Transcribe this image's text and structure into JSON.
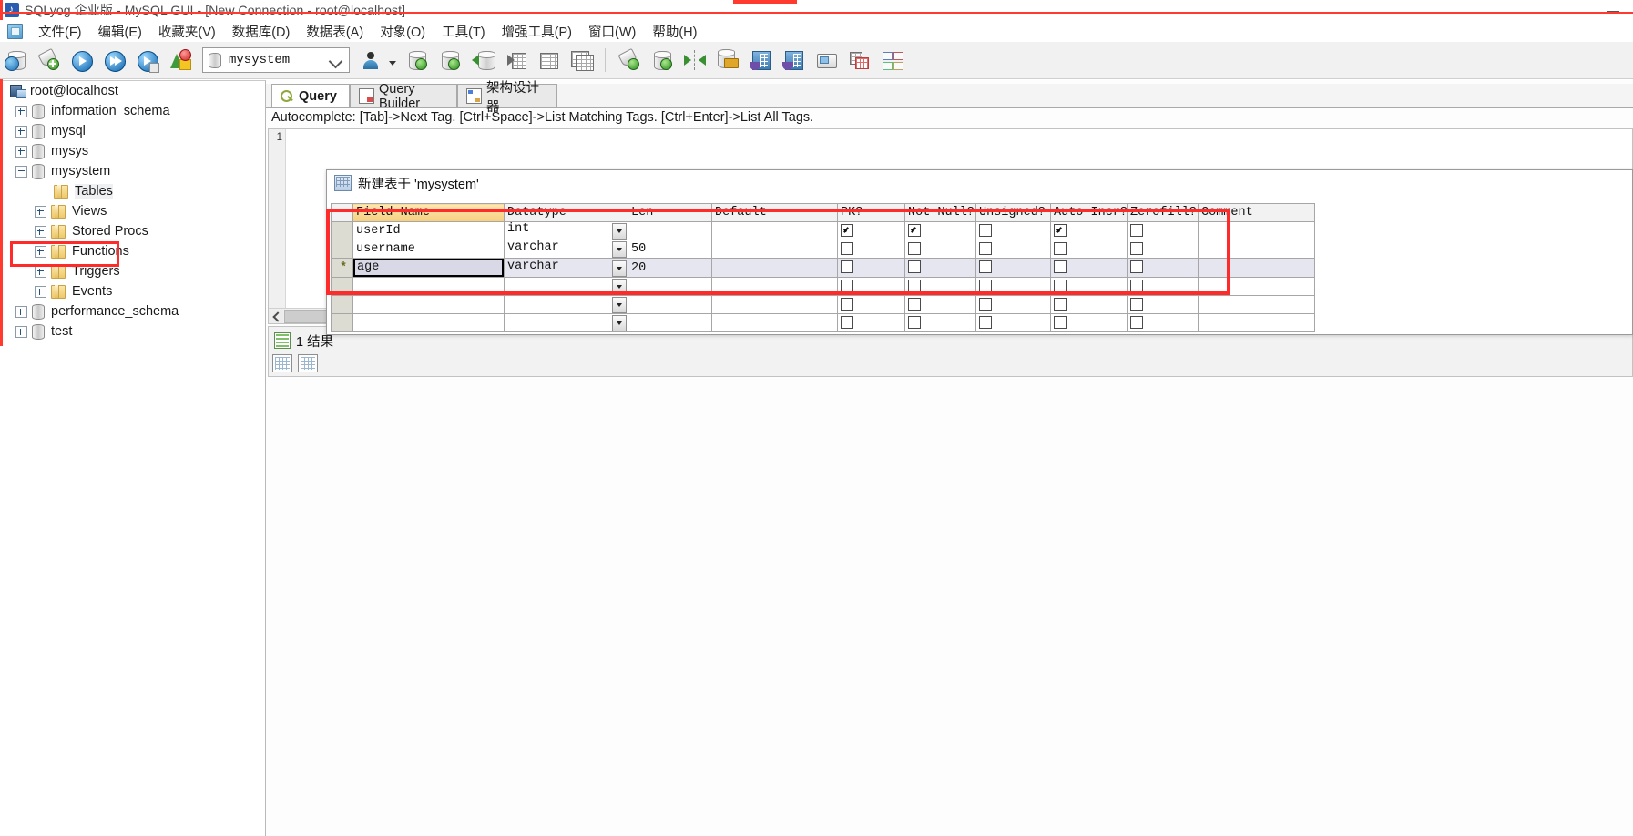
{
  "window": {
    "title": "SQLyog 企业版 - MySQL GUI - [New Connection - root@localhost]",
    "minimize_label": "—"
  },
  "menu": {
    "items": [
      {
        "label": "文件(F)",
        "name": "menu-file"
      },
      {
        "label": "编辑(E)",
        "name": "menu-edit"
      },
      {
        "label": "收藏夹(V)",
        "name": "menu-favorites"
      },
      {
        "label": "数据库(D)",
        "name": "menu-database"
      },
      {
        "label": "数据表(A)",
        "name": "menu-table"
      },
      {
        "label": "对象(O)",
        "name": "menu-object"
      },
      {
        "label": "工具(T)",
        "name": "menu-tools"
      },
      {
        "label": "增强工具(P)",
        "name": "menu-powertools"
      },
      {
        "label": "窗口(W)",
        "name": "menu-window"
      },
      {
        "label": "帮助(H)",
        "name": "menu-help"
      }
    ]
  },
  "toolbar": {
    "database_selector": {
      "value": "mysystem",
      "icon": "database-icon",
      "chevron": "chevron-down-icon"
    },
    "icons": [
      "new-connection-icon",
      "new-query-icon",
      "execute-query-icon",
      "execute-all-queries-icon",
      "execute-query-stop-icon",
      "refresh-objects-icon",
      "user-manager-icon",
      "import-database-icon",
      "export-database-icon",
      "restore-backup-icon",
      "table-data-icon",
      "table-info-icon",
      "copy-table-icon",
      "format-query-icon",
      "refresh-database-icon",
      "sync-data-icon",
      "backup-database-icon",
      "schema-sync-icon",
      "migration-icon",
      "scheduled-backup-icon",
      "notification-icon"
    ]
  },
  "sidebar": {
    "root": {
      "label": "root@localhost",
      "icon": "server-icon"
    },
    "items": [
      {
        "label": "information_schema",
        "icon": "database-icon",
        "expander": "plus",
        "indent": 1
      },
      {
        "label": "mysql",
        "icon": "database-icon",
        "expander": "plus",
        "indent": 1
      },
      {
        "label": "mysys",
        "icon": "database-icon",
        "expander": "plus",
        "indent": 1
      },
      {
        "label": "mysystem",
        "icon": "database-icon",
        "expander": "minus",
        "indent": 1,
        "highlighted": true
      },
      {
        "label": "Tables",
        "icon": "folder-icon",
        "expander": "none",
        "indent": 2,
        "selected": true
      },
      {
        "label": "Views",
        "icon": "folder-icon",
        "expander": "plus",
        "indent": 2
      },
      {
        "label": "Stored Procs",
        "icon": "folder-icon",
        "expander": "plus",
        "indent": 2
      },
      {
        "label": "Functions",
        "icon": "folder-icon",
        "expander": "plus",
        "indent": 2
      },
      {
        "label": "Triggers",
        "icon": "folder-icon",
        "expander": "plus",
        "indent": 2
      },
      {
        "label": "Events",
        "icon": "folder-icon",
        "expander": "plus",
        "indent": 2
      },
      {
        "label": "performance_schema",
        "icon": "database-icon",
        "expander": "plus",
        "indent": 1
      },
      {
        "label": "test",
        "icon": "database-icon",
        "expander": "plus",
        "indent": 1
      }
    ]
  },
  "editor_area": {
    "tabs": [
      {
        "label": "Query",
        "icon": "query-icon",
        "active": true
      },
      {
        "label": "Query Builder",
        "icon": "query-builder-icon",
        "active": false
      },
      {
        "label": "架构设计器",
        "icon": "schema-designer-icon",
        "active": false
      }
    ],
    "autocomplete_hint": "Autocomplete: [Tab]->Next Tag. [Ctrl+Space]->List Matching Tags. [Ctrl+Enter]->List All Tags.",
    "line_numbers": [
      "1"
    ],
    "content": ""
  },
  "results": {
    "tab_label": "1 结果",
    "icon": "result-grid-icon"
  },
  "dialog": {
    "title": "新建表于 'mysystem'",
    "icon": "new-table-icon",
    "columns": [
      "Field Name",
      "Datatype",
      "Len",
      "Default",
      "PK?",
      "Not Null?",
      "Unsigned?",
      "Auto Incr?",
      "Zerofill?",
      "Comment"
    ],
    "rows": [
      {
        "marker": "",
        "field_name": "userId",
        "datatype": "int",
        "len": "",
        "default": "",
        "pk": true,
        "not_null": true,
        "unsigned": false,
        "auto_incr": true,
        "zerofill": false,
        "comment": "",
        "selected": false,
        "editing": false
      },
      {
        "marker": "",
        "field_name": "username",
        "datatype": "varchar",
        "len": "50",
        "default": "",
        "pk": false,
        "not_null": false,
        "unsigned": false,
        "auto_incr": false,
        "zerofill": false,
        "comment": "",
        "selected": false,
        "editing": false
      },
      {
        "marker": "*",
        "field_name": "age",
        "datatype": "varchar",
        "len": "20",
        "default": "",
        "pk": false,
        "not_null": false,
        "unsigned": false,
        "auto_incr": false,
        "zerofill": false,
        "comment": "",
        "selected": true,
        "editing": true
      },
      {
        "marker": "",
        "field_name": "",
        "datatype": "",
        "len": "",
        "default": "",
        "pk": false,
        "not_null": false,
        "unsigned": false,
        "auto_incr": false,
        "zerofill": false,
        "comment": "",
        "selected": false,
        "editing": false
      },
      {
        "marker": "",
        "field_name": "",
        "datatype": "",
        "len": "",
        "default": "",
        "pk": false,
        "not_null": false,
        "unsigned": false,
        "auto_incr": false,
        "zerofill": false,
        "comment": "",
        "selected": false,
        "editing": false
      },
      {
        "marker": "",
        "field_name": "",
        "datatype": "",
        "len": "",
        "default": "",
        "pk": false,
        "not_null": false,
        "unsigned": false,
        "auto_incr": false,
        "zerofill": false,
        "comment": "",
        "selected": false,
        "editing": false
      }
    ]
  },
  "annotations": {
    "accent_red": "#ff2b2b"
  }
}
